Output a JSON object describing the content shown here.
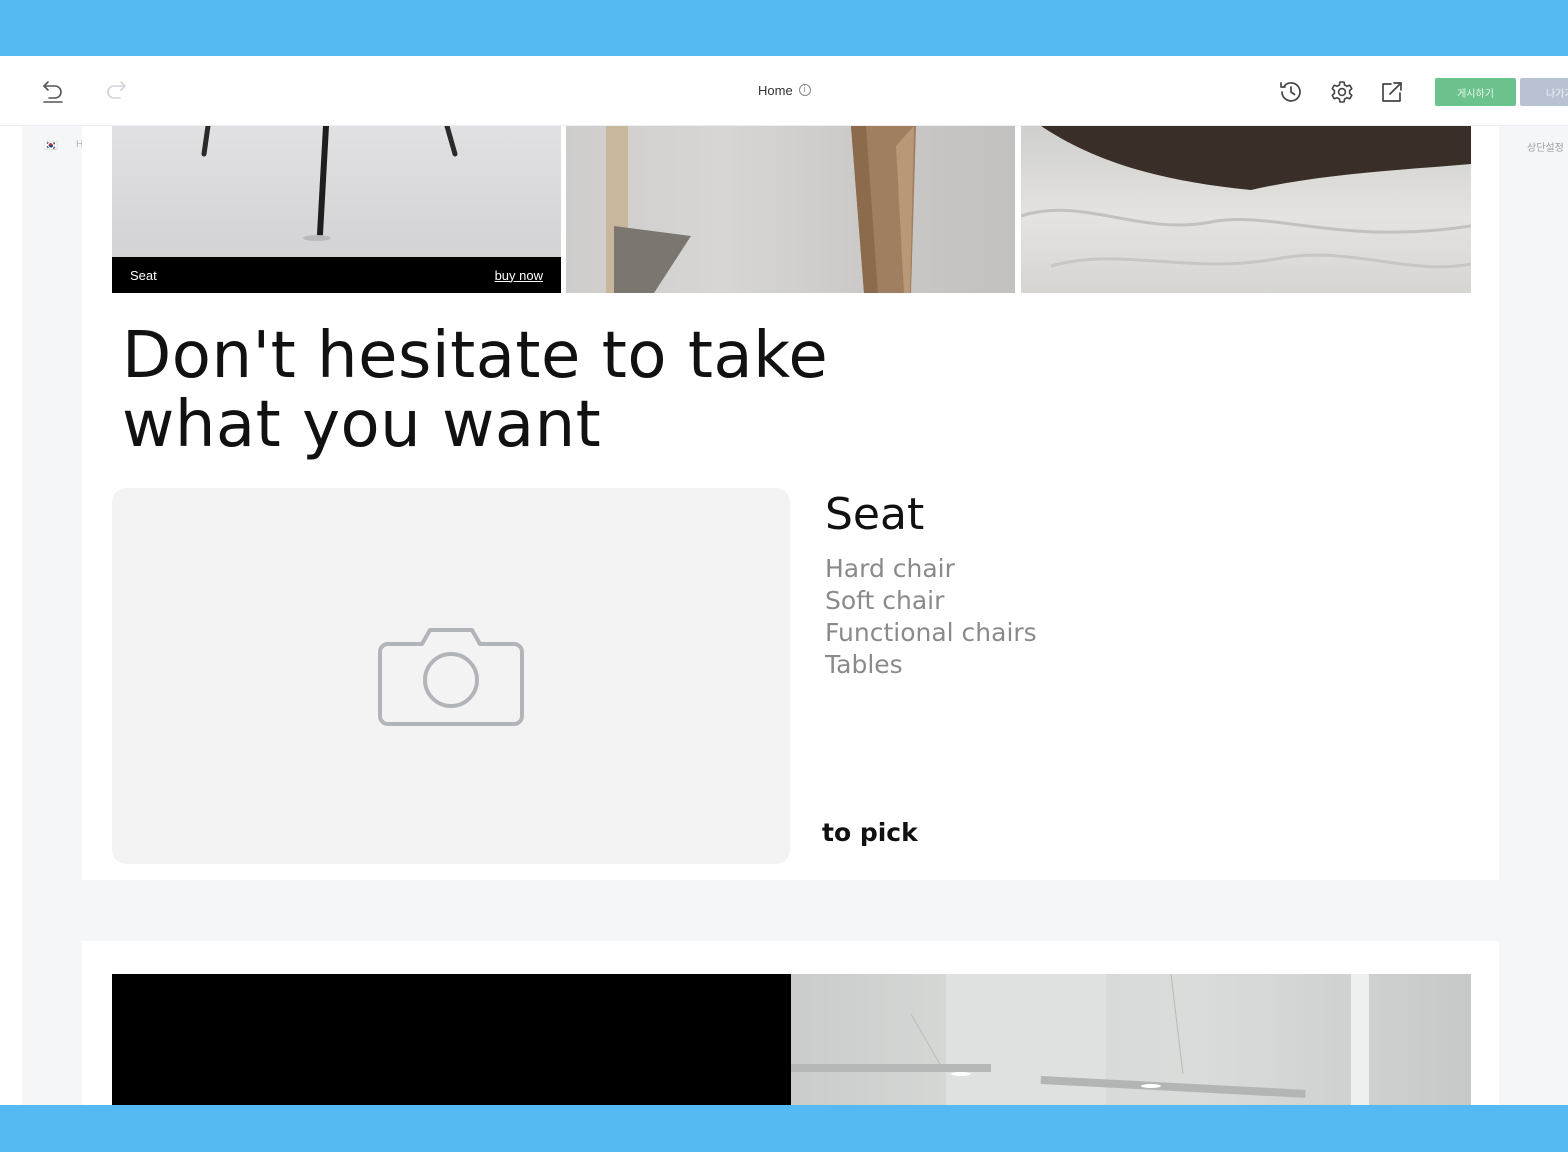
{
  "toolbar": {
    "page_title": "Home",
    "info_glyph": "i",
    "publish_label": "게시하기",
    "exit_label": "나가기",
    "icons": [
      "undo-icon",
      "redo-icon",
      "history-icon",
      "gear-icon",
      "external-link-icon"
    ]
  },
  "sidebar": {
    "language_flag": "🇰🇷",
    "language_code": "H",
    "right_label": "상단설정"
  },
  "gallery": {
    "tile1_caption": "Seat",
    "tile1_link": "buy now"
  },
  "headline": {
    "line1": "Don't hesitate to take",
    "line2": "what you want"
  },
  "category": {
    "title": "Seat",
    "items": [
      "Hard chair",
      "Soft chair",
      "Functional chairs",
      "Tables"
    ],
    "link": "to pick",
    "placeholder_icon": "camera-icon"
  },
  "colors": {
    "frame": "#55b9f3",
    "publish_button": "#6cc28d",
    "exit_button": "#b9c2d3"
  }
}
